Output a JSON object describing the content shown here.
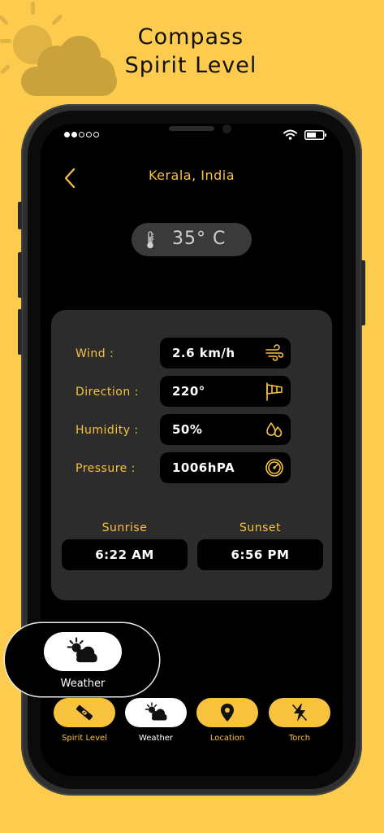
{
  "promo": {
    "headline_line1": "Compass",
    "headline_line2": "Spirit Level",
    "icon": "sun-cloud-icon",
    "background_color": "#FDCC4E"
  },
  "status_bar": {
    "signal_dots_filled": 2,
    "signal_dots_total": 5,
    "icons": [
      "wifi-icon",
      "battery-icon"
    ]
  },
  "header": {
    "back_icon": "chevron-left-icon",
    "location": "Kerala, India"
  },
  "temperature": {
    "icon": "thermometer-icon",
    "value": "35° C"
  },
  "weather_rows": [
    {
      "label": "Wind :",
      "value": "2.6 km/h",
      "icon": "wind-icon"
    },
    {
      "label": "Direction :",
      "value": "220°",
      "icon": "windsock-icon"
    },
    {
      "label": "Humidity :",
      "value": "50%",
      "icon": "water-drops-icon"
    },
    {
      "label": "Pressure :",
      "value": "1006hPA",
      "icon": "gauge-icon"
    }
  ],
  "sun": {
    "sunrise_label": "Sunrise",
    "sunrise_value": "6:22 AM",
    "sunset_label": "Sunset",
    "sunset_value": "6:56 PM"
  },
  "nav": {
    "items": [
      {
        "label": "Spirit Level",
        "icon": "spirit-level-icon"
      },
      {
        "label": "Weather",
        "icon": "sun-cloud-icon"
      },
      {
        "label": "Location",
        "icon": "location-pin-icon"
      },
      {
        "label": "Torch",
        "icon": "flash-icon"
      }
    ],
    "active_index": 1
  },
  "zoom_callout": {
    "label": "Weather",
    "icon": "sun-cloud-icon"
  },
  "colors": {
    "accent": "#F7C23E",
    "card": "#2C2C2C",
    "screen": "#000000"
  }
}
